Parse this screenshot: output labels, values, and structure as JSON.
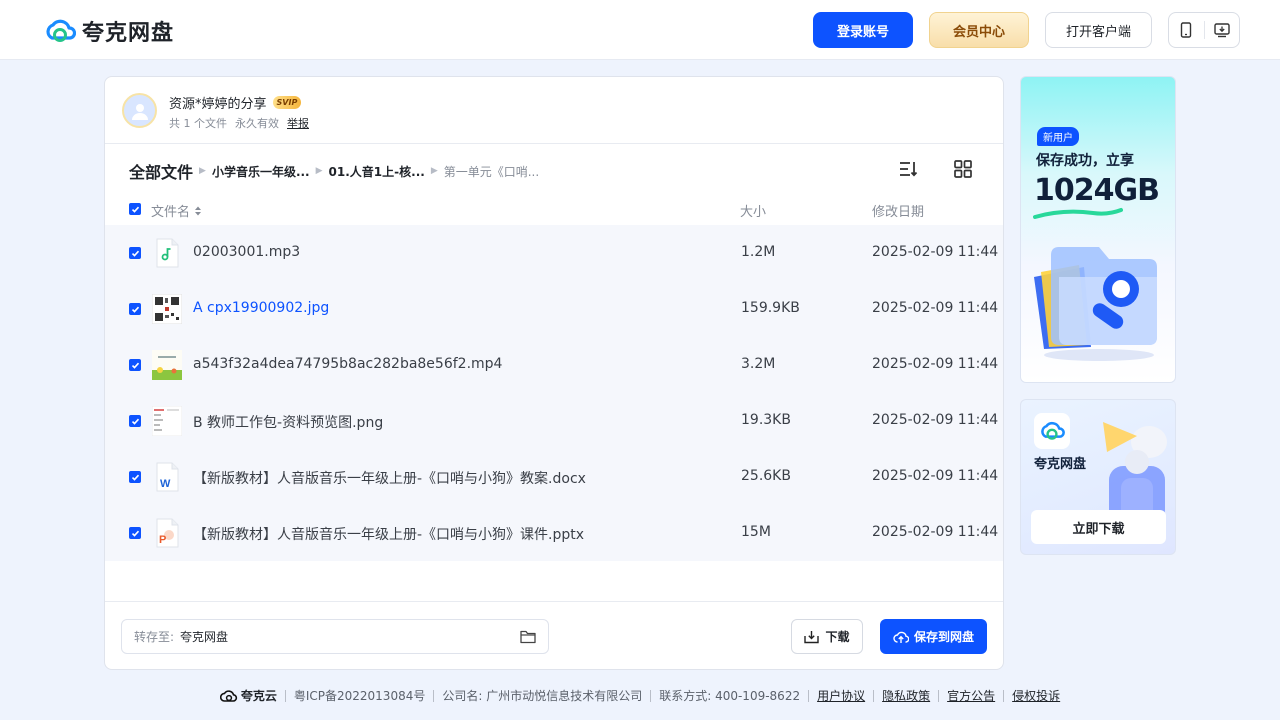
{
  "header": {
    "brand": "夸克网盘",
    "login_label": "登录账号",
    "vip_label": "会员中心",
    "client_label": "打开客户端"
  },
  "share": {
    "title": "资源*婷婷的分享",
    "badge": "SVIP",
    "count": "共 1 个文件",
    "validity": "永久有效",
    "report": "举报"
  },
  "breadcrumb": {
    "root": "全部文件",
    "items": [
      "小学音乐一年级...",
      "01.人音1上-核...",
      "第一单元《口哨..."
    ]
  },
  "columns": {
    "name": "文件名",
    "size": "大小",
    "date": "修改日期"
  },
  "files": [
    {
      "name": "02003001.mp3",
      "size": "1.2M",
      "date": "2025-02-09 11:44",
      "icon": "audio-file-icon"
    },
    {
      "name": "A cpx19900902.jpg",
      "size": "159.9KB",
      "date": "2025-02-09 11:44",
      "icon": "qr-image-thumbnail"
    },
    {
      "name": "a543f32a4dea74795b8ac282ba8e56f2.mp4",
      "size": "3.2M",
      "date": "2025-02-09 11:44",
      "icon": "video-thumbnail"
    },
    {
      "name": "B 教师工作包-资料预览图.png",
      "size": "19.3KB",
      "date": "2025-02-09 11:44",
      "icon": "image-thumbnail"
    },
    {
      "name": "【新版教材】人音版音乐一年级上册-《口哨与小狗》教案.docx",
      "size": "25.6KB",
      "date": "2025-02-09 11:44",
      "icon": "word-file-icon"
    },
    {
      "name": "【新版教材】人音版音乐一年级上册-《口哨与小狗》课件.pptx",
      "size": "15M",
      "date": "2025-02-09 11:44",
      "icon": "ppt-file-icon"
    }
  ],
  "footer_bar": {
    "saveto_label": "转存至:",
    "saveto_value": "夸克网盘",
    "download_label": "下载",
    "save_label": "保存到网盘"
  },
  "ad_promo": {
    "tag": "新用户",
    "line1": "保存成功，立享",
    "line2": "1024GB"
  },
  "ad_app": {
    "name": "夸克网盘",
    "button": "立即下载"
  },
  "site_footer": {
    "brand": "夸克云",
    "icp": "粤ICP备2022013084号",
    "company": "公司名: 广州市动悦信息技术有限公司",
    "contact": "联系方式: 400-109-8622",
    "links": [
      "用户协议",
      "隐私政策",
      "官方公告",
      "侵权投诉"
    ]
  },
  "colors": {
    "accent": "#0d53ff",
    "link": "#0d53ff",
    "vip_gold": "#f8deaa"
  }
}
